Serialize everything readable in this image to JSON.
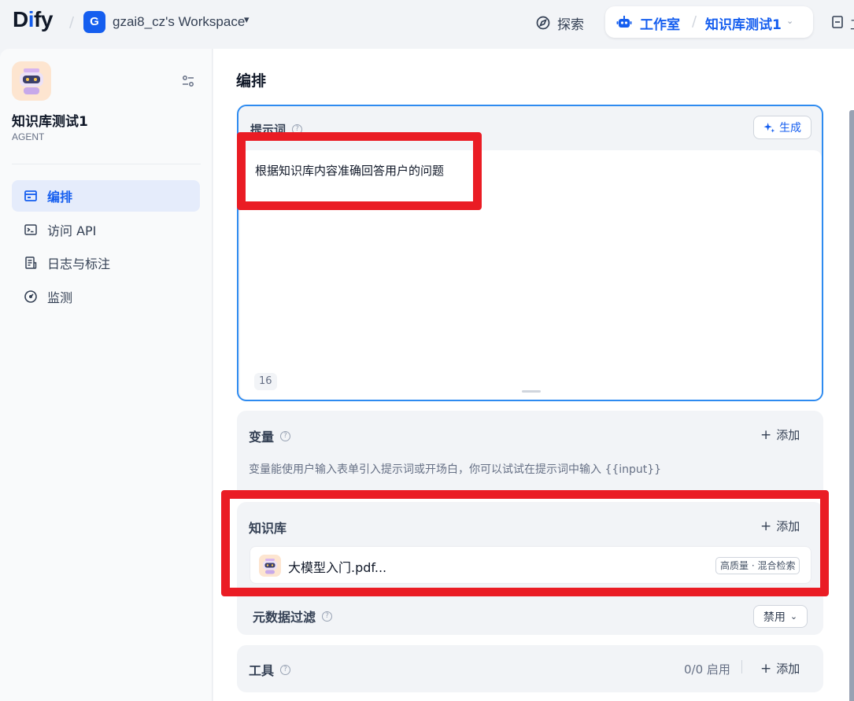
{
  "brand": {
    "logo_pre": "D",
    "logo_i": "i",
    "logo_post": "fy"
  },
  "workspace": {
    "initial": "G",
    "name": "gzai8_cz's Workspace"
  },
  "topnav": {
    "explore": "探索",
    "studio": "工作室",
    "current_app": "知识库测试1",
    "edge_text": "工"
  },
  "sidebar": {
    "app_name": "知识库测试1",
    "app_type": "AGENT",
    "items": [
      {
        "label": "编排",
        "icon": "layout-icon",
        "active": true
      },
      {
        "label": "访问 API",
        "icon": "terminal-icon",
        "active": false
      },
      {
        "label": "日志与标注",
        "icon": "file-list-icon",
        "active": false
      },
      {
        "label": "监测",
        "icon": "gauge-icon",
        "active": false
      }
    ]
  },
  "main": {
    "title": "编排",
    "prompt": {
      "label": "提示词",
      "generate_label": "生成",
      "text": "根据知识库内容准确回答用户的问题",
      "char_count": "16"
    },
    "variables": {
      "label": "变量",
      "add_label": "添加",
      "description": "变量能使用户输入表单引入提示词或开场白，你可以试试在提示词中输入 {{input}}"
    },
    "knowledge": {
      "label": "知识库",
      "add_label": "添加",
      "datasets": [
        {
          "name": "大模型入门.pdf...",
          "tag": "高质量 · 混合检索"
        }
      ]
    },
    "metadata_filter": {
      "label": "元数据过滤",
      "value": "禁用"
    },
    "tools": {
      "label": "工具",
      "count": "0/0 启用",
      "add_label": "添加"
    }
  },
  "colors": {
    "accent": "#155eef",
    "highlight": "#ea1c24",
    "prompt_border": "#2e8bf0"
  }
}
